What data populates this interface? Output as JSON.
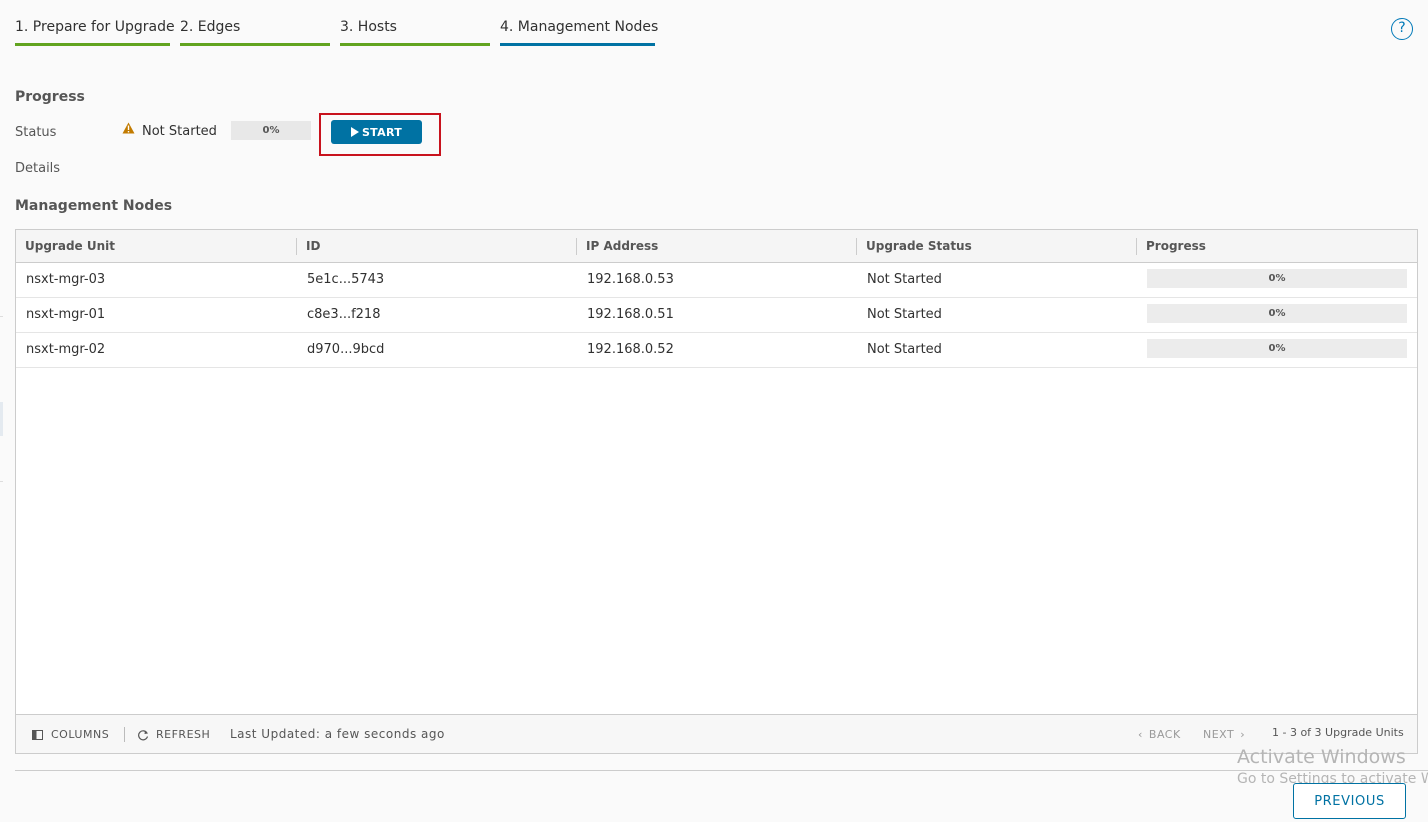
{
  "steps": [
    {
      "label": "1. Prepare for Upgrade",
      "state": "complete"
    },
    {
      "label": "2. Edges",
      "state": "complete"
    },
    {
      "label": "3. Hosts",
      "state": "complete"
    },
    {
      "label": "4. Management Nodes",
      "state": "active"
    }
  ],
  "help_icon_glyph": "?",
  "progress_section": {
    "title": "Progress",
    "status_label": "Status",
    "status_value": "Not Started",
    "progress_text": "0%",
    "start_label": "START",
    "details_label": "Details"
  },
  "nodes_section": {
    "title": "Management Nodes",
    "columns": [
      "Upgrade Unit",
      "ID",
      "IP Address",
      "Upgrade Status",
      "Progress"
    ],
    "rows": [
      {
        "unit": "nsxt-mgr-03",
        "id": "5e1c...5743",
        "ip": "192.168.0.53",
        "status": "Not Started",
        "progress": "0%"
      },
      {
        "unit": "nsxt-mgr-01",
        "id": "c8e3...f218",
        "ip": "192.168.0.51",
        "status": "Not Started",
        "progress": "0%"
      },
      {
        "unit": "nsxt-mgr-02",
        "id": "d970...9bcd",
        "ip": "192.168.0.52",
        "status": "Not Started",
        "progress": "0%"
      }
    ]
  },
  "footer": {
    "columns_label": "COLUMNS",
    "refresh_label": "REFRESH",
    "last_updated": "Last Updated: a few seconds ago",
    "back_label": "BACK",
    "next_label": "NEXT",
    "count": "1 - 3 of 3 Upgrade Units"
  },
  "watermark": {
    "line1": "Activate Windows",
    "line2": "Go to Settings to activate Wi"
  },
  "previous_label": "PREVIOUS",
  "colors": {
    "accent": "#0072a3",
    "complete": "#62a420",
    "highlight": "#c8121d",
    "warning": "#c27b00"
  }
}
